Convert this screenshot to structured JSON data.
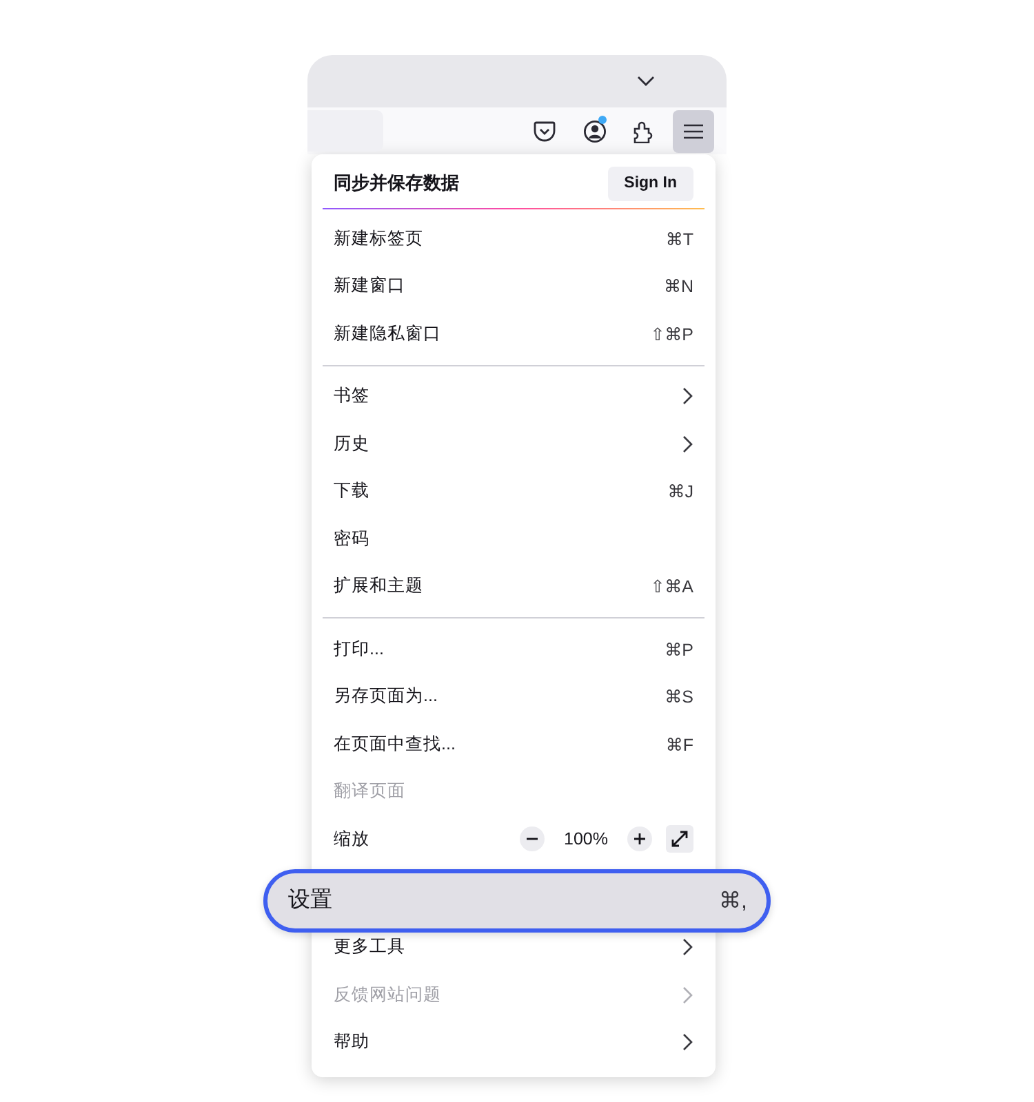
{
  "toolbar": {
    "buttons": [
      {
        "kind": "pocket",
        "selected": false,
        "badge": false
      },
      {
        "kind": "account",
        "selected": false,
        "badge": true
      },
      {
        "kind": "extensions",
        "selected": false,
        "badge": false
      },
      {
        "kind": "menu",
        "selected": true,
        "badge": false
      }
    ]
  },
  "menu": {
    "header": {
      "title": "同步并保存数据",
      "button": "Sign In"
    },
    "groups": [
      [
        {
          "kind": "item",
          "label": "新建标签页",
          "shortcut": "⌘T",
          "disabled": false,
          "highlighted": false
        },
        {
          "kind": "item",
          "label": "新建窗口",
          "shortcut": "⌘N",
          "disabled": false,
          "highlighted": false
        },
        {
          "kind": "item",
          "label": "新建隐私窗口",
          "shortcut": "⇧⌘P",
          "disabled": false,
          "highlighted": false
        }
      ],
      [
        {
          "kind": "submenu",
          "label": "书签",
          "disabled": false,
          "highlighted": false
        },
        {
          "kind": "submenu",
          "label": "历史",
          "disabled": false,
          "highlighted": false
        },
        {
          "kind": "item",
          "label": "下载",
          "shortcut": "⌘J",
          "disabled": false,
          "highlighted": false
        },
        {
          "kind": "item",
          "label": "密码",
          "disabled": false,
          "highlighted": false
        },
        {
          "kind": "item",
          "label": "扩展和主题",
          "shortcut": "⇧⌘A",
          "disabled": false,
          "highlighted": false
        }
      ],
      [
        {
          "kind": "item",
          "label": "打印...",
          "shortcut": "⌘P",
          "disabled": false,
          "highlighted": false
        },
        {
          "kind": "item",
          "label": "另存页面为...",
          "shortcut": "⌘S",
          "disabled": false,
          "highlighted": false
        },
        {
          "kind": "item",
          "label": "在页面中查找...",
          "shortcut": "⌘F",
          "disabled": false,
          "highlighted": false
        },
        {
          "kind": "item",
          "label": "翻译页面",
          "disabled": true,
          "highlighted": false
        },
        {
          "kind": "zoom",
          "label": "缩放",
          "value": "100%",
          "disabled": false,
          "highlighted": false
        },
        {
          "kind": "item",
          "label": "设置",
          "shortcut": "⌘,",
          "disabled": false,
          "highlighted": true
        },
        {
          "kind": "submenu",
          "label": "更多工具",
          "disabled": false,
          "highlighted": false
        },
        {
          "kind": "submenu",
          "label": "反馈网站问题",
          "disabled": true,
          "highlighted": false
        },
        {
          "kind": "submenu",
          "label": "帮助",
          "disabled": false,
          "highlighted": false
        }
      ]
    ]
  }
}
